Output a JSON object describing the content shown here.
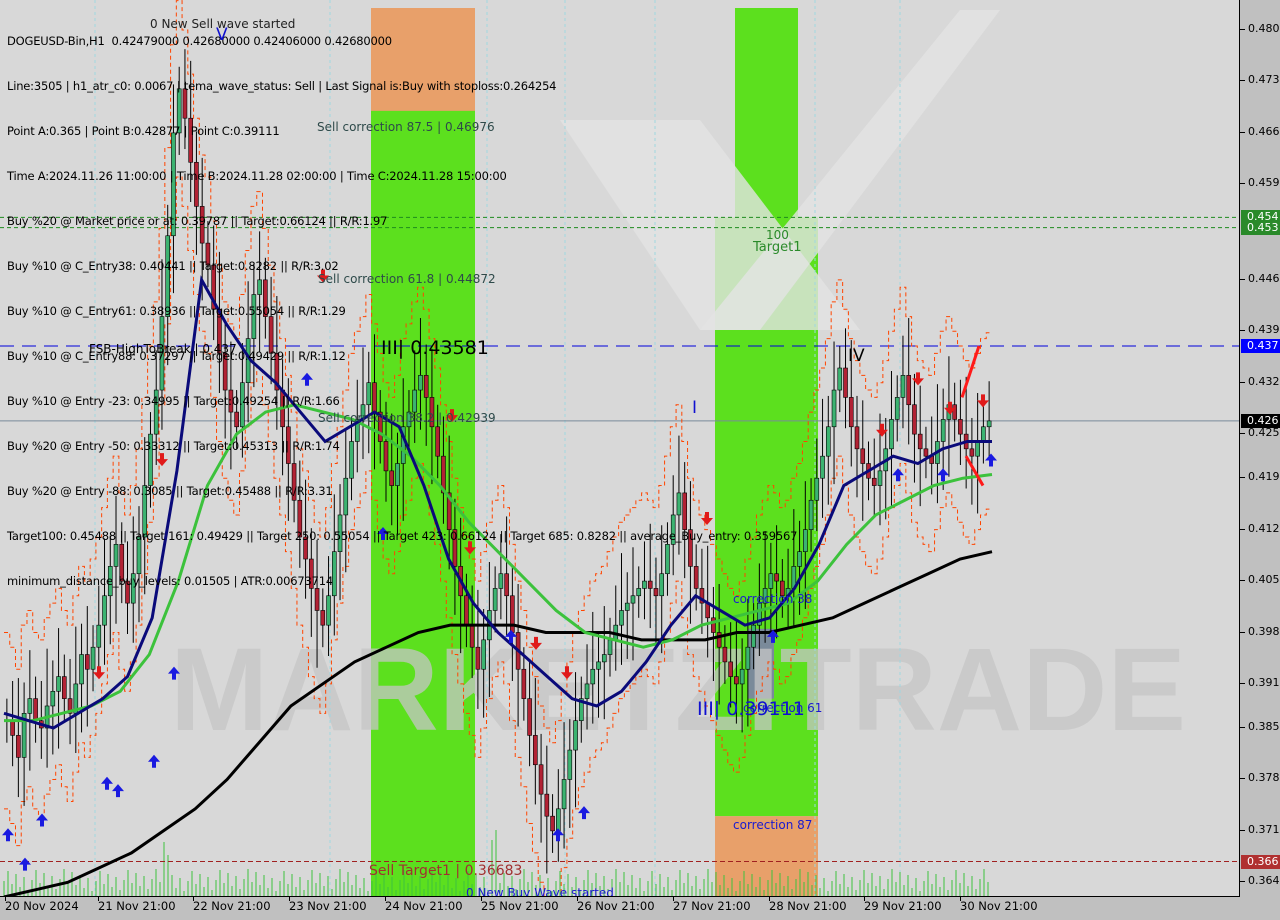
{
  "header": {
    "symbol_line": "DOGEUSD-Bin,H1  0.42479000 0.42680000 0.42406000 0.42680000",
    "info_lines": [
      "Line:3505 | h1_atr_c0: 0.0067 | tema_wave_status: Sell | Last Signal is:Buy with stoploss:0.264254",
      "Point A:0.365 | Point B:0.42877 | Point C:0.39111",
      "Time A:2024.11.26 11:00:00 | Time B:2024.11.28 02:00:00 | Time C:2024.11.28 15:00:00",
      "Buy %20 @ Market price or at: 0.39787 || Target:0.66124 || R/R:1.97",
      "Buy %10 @ C_Entry38: 0.40441 || Target:0.8282 || R/R:3.02",
      "Buy %10 @ C_Entry61: 0.38936 || Target:0.55054 || R/R:1.29",
      "Buy %10 @ C_Entry88: 0.37297 || Target:0.49429 || R/R:1.12",
      "Buy %10 @ Entry -23: 0.34995 || Target:0.49254 || R/R:1.66",
      "Buy %20 @ Entry -50: 0.33312 || Target:0.45313 || R/R:1.74",
      "Buy %20 @ Entry -88: 0.3085 || Target:0.45488 || R/R:3.31",
      "Target100: 0.45488 || Target 161: 0.49429 || Target 250: 0.55054 || Target 423: 0.66124 || Target 685: 0.8282 || average_Buy_entry: 0.359567",
      "minimum_distance_buy_levels: 0.01505 | ATR:0.00673714"
    ],
    "overlay_text": "0 New Sell wave started"
  },
  "annotations": {
    "sell_corr_875": "Sell correction 87.5 | 0.46976",
    "sell_corr_618": "Sell correction 61.8 | 0.44872",
    "sell_corr_382": "Sell correction 38.2 | 0.42939",
    "fsb": "FSB-HighToBreak | 0.437",
    "wave3_high": "III| 0.43581",
    "wave3_low": "III| 0.39111",
    "wave4": "IV",
    "wave5": "V",
    "wave1": "I",
    "target1_num": "100",
    "target1": "Target1",
    "correction38": "correction 38",
    "correction61": "correction 61",
    "correction87": "correction 87",
    "sell_target1": "Sell Target1 | 0.36683",
    "new_buy_wave": "0 New Buy Wave started",
    "watermark": "MARKETZITRADE"
  },
  "colors": {
    "background": "#d8d8d8",
    "bull_candle": "#3cb371",
    "bear_candle": "#b22234",
    "ma_fast": "#0a0a7a",
    "ma_mid": "#3cc23c",
    "ma_slow": "#000000",
    "zone_green": "#5ce01e",
    "zone_orange": "#e8a06a",
    "fsb_line": "#0000dd",
    "target_line": "#1e8b1e",
    "sell_target_line": "#a02020",
    "envelope": "#ff4500",
    "price_tag_current": "#000000",
    "price_tag_fsb": "#0000ff",
    "price_tag_target": "#2a8a2a",
    "price_tag_sell": "#b03030"
  },
  "chart_data": {
    "type": "candlestick",
    "title": "DOGEUSD-Bin,H1",
    "ohlc_last": {
      "open": 0.42479,
      "high": 0.4268,
      "low": 0.42406,
      "close": 0.4268
    },
    "ylim": [
      0.362,
      0.483
    ],
    "y_ticks": [
      "0.480",
      "0.473",
      "0.466",
      "0.459",
      "0.446",
      "0.439",
      "0.432",
      "0.425",
      "0.419",
      "0.412",
      "0.405",
      "0.398",
      "0.391",
      "0.385",
      "0.378",
      "0.371",
      "0.364"
    ],
    "y_tick_values": [
      0.48,
      0.473,
      0.466,
      0.459,
      0.446,
      0.439,
      0.432,
      0.425,
      0.419,
      0.412,
      0.405,
      0.398,
      0.391,
      0.385,
      0.378,
      0.371,
      0.364
    ],
    "x_ticks": [
      "20 Nov 2024",
      "21 Nov 21:00",
      "22 Nov 21:00",
      "23 Nov 21:00",
      "24 Nov 21:00",
      "25 Nov 21:00",
      "26 Nov 21:00",
      "27 Nov 21:00",
      "28 Nov 21:00",
      "29 Nov 21:00",
      "30 Nov 21:00"
    ],
    "price_tags": [
      {
        "label": "0.454",
        "value": 0.4545,
        "kind": "target"
      },
      {
        "label": "0.453",
        "value": 0.4531,
        "kind": "target"
      },
      {
        "label": "0.437",
        "value": 0.437,
        "kind": "fsb"
      },
      {
        "label": "0.426",
        "value": 0.4268,
        "kind": "current"
      },
      {
        "label": "0.366",
        "value": 0.36683,
        "kind": "sell"
      }
    ],
    "levels": {
      "fsb_high_to_break": 0.437,
      "target1_a": 0.4545,
      "target1_b": 0.4531,
      "sell_target1": 0.36683,
      "current": 0.4268
    },
    "close_path": [
      0.386,
      0.384,
      0.381,
      0.387,
      0.389,
      0.386,
      0.385,
      0.388,
      0.39,
      0.392,
      0.389,
      0.387,
      0.391,
      0.395,
      0.393,
      0.396,
      0.399,
      0.403,
      0.407,
      0.41,
      0.405,
      0.402,
      0.406,
      0.411,
      0.418,
      0.425,
      0.431,
      0.441,
      0.452,
      0.466,
      0.472,
      0.468,
      0.462,
      0.456,
      0.451,
      0.448,
      0.442,
      0.436,
      0.431,
      0.428,
      0.426,
      0.432,
      0.438,
      0.444,
      0.446,
      0.441,
      0.436,
      0.431,
      0.426,
      0.421,
      0.416,
      0.411,
      0.408,
      0.404,
      0.401,
      0.399,
      0.403,
      0.409,
      0.414,
      0.419,
      0.424,
      0.427,
      0.429,
      0.432,
      0.428,
      0.424,
      0.42,
      0.418,
      0.421,
      0.426,
      0.428,
      0.431,
      0.433,
      0.43,
      0.426,
      0.422,
      0.417,
      0.412,
      0.407,
      0.403,
      0.399,
      0.396,
      0.393,
      0.397,
      0.401,
      0.404,
      0.406,
      0.403,
      0.398,
      0.393,
      0.389,
      0.384,
      0.38,
      0.376,
      0.373,
      0.371,
      0.374,
      0.378,
      0.382,
      0.386,
      0.389,
      0.391,
      0.393,
      0.394,
      0.395,
      0.397,
      0.399,
      0.401,
      0.402,
      0.403,
      0.404,
      0.405,
      0.404,
      0.403,
      0.406,
      0.41,
      0.414,
      0.417,
      0.412,
      0.407,
      0.404,
      0.402,
      0.4,
      0.398,
      0.396,
      0.394,
      0.392,
      0.391,
      0.393,
      0.396,
      0.399,
      0.402,
      0.404,
      0.406,
      0.405,
      0.403,
      0.404,
      0.407,
      0.409,
      0.412,
      0.416,
      0.419,
      0.422,
      0.426,
      0.431,
      0.434,
      0.43,
      0.426,
      0.423,
      0.421,
      0.419,
      0.418,
      0.42,
      0.423,
      0.427,
      0.43,
      0.433,
      0.429,
      0.425,
      0.423,
      0.422,
      0.421,
      0.424,
      0.427,
      0.429,
      0.427,
      0.425,
      0.423,
      0.422,
      0.424,
      0.426,
      0.4268
    ],
    "ma_slow_path": [
      0.362,
      0.363,
      0.364,
      0.366,
      0.368,
      0.371,
      0.374,
      0.378,
      0.383,
      0.388,
      0.391,
      0.394,
      0.396,
      0.398,
      0.399,
      0.399,
      0.399,
      0.398,
      0.398,
      0.398,
      0.397,
      0.397,
      0.397,
      0.398,
      0.398,
      0.399,
      0.4,
      0.402,
      0.404,
      0.406,
      0.408,
      0.409
    ],
    "ma_mid_path": [
      0.386,
      0.386,
      0.387,
      0.388,
      0.39,
      0.395,
      0.405,
      0.418,
      0.425,
      0.428,
      0.429,
      0.428,
      0.427,
      0.425,
      0.422,
      0.418,
      0.413,
      0.409,
      0.405,
      0.401,
      0.398,
      0.397,
      0.396,
      0.397,
      0.399,
      0.4,
      0.401,
      0.402,
      0.405,
      0.41,
      0.414,
      0.416,
      0.418,
      0.419,
      0.4195
    ],
    "ma_fast_path": [
      0.387,
      0.386,
      0.385,
      0.387,
      0.389,
      0.392,
      0.4,
      0.42,
      0.446,
      0.44,
      0.435,
      0.432,
      0.428,
      0.424,
      0.426,
      0.428,
      0.426,
      0.418,
      0.408,
      0.402,
      0.398,
      0.395,
      0.392,
      0.389,
      0.388,
      0.39,
      0.394,
      0.399,
      0.403,
      0.401,
      0.399,
      0.4,
      0.404,
      0.41,
      0.418,
      0.42,
      0.422,
      0.421,
      0.423,
      0.424,
      0.424
    ],
    "zones": [
      {
        "name": "orange-top",
        "from": 0.465,
        "to": 0.483,
        "color": "orange"
      },
      {
        "name": "green-a",
        "from": 0.362,
        "to": 0.469,
        "color": "green"
      },
      {
        "name": "green-b-top",
        "from": 0.453,
        "to": 0.483,
        "color": "green"
      },
      {
        "name": "green-b",
        "from": 0.373,
        "to": 0.4545,
        "color": "green"
      },
      {
        "name": "orange-bottom",
        "from": 0.362,
        "to": 0.373,
        "color": "orange"
      }
    ]
  }
}
